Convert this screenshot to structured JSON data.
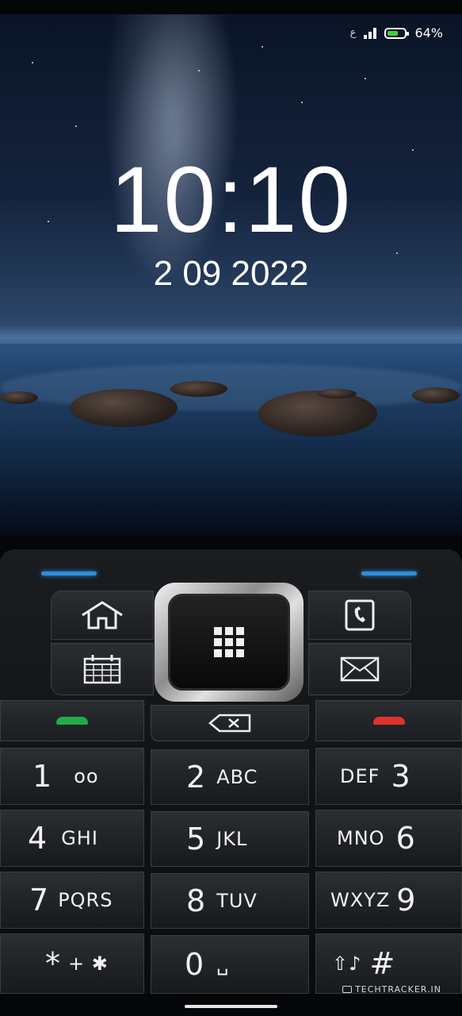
{
  "status": {
    "sim_label": "ع",
    "battery_percent_text": "64%",
    "battery_level": 0.64,
    "battery_color": "#3fd13b"
  },
  "lockscreen": {
    "time": "10:10",
    "date": "2 09 2022"
  },
  "keypad": {
    "accent_color": "#2f8ddf",
    "soft_keys": {
      "home": "home-icon",
      "contacts": "contacts-icon",
      "calendar": "calendar-icon",
      "messages": "envelope-icon",
      "menu": "app-grid-icon",
      "backspace": "backspace-icon",
      "call": "call-icon",
      "end": "end-call-icon"
    },
    "keys": [
      {
        "num": "1",
        "letters": "ᴏᴏ"
      },
      {
        "num": "2",
        "letters": "ABC"
      },
      {
        "num": "3",
        "letters": "DEF"
      },
      {
        "num": "4",
        "letters": "GHI"
      },
      {
        "num": "5",
        "letters": "JKL"
      },
      {
        "num": "6",
        "letters": "MNO"
      },
      {
        "num": "7",
        "letters": "PQRS"
      },
      {
        "num": "8",
        "letters": "TUV"
      },
      {
        "num": "9",
        "letters": "WXYZ"
      },
      {
        "num": "*",
        "letters": "+ ✱"
      },
      {
        "num": "0",
        "letters": "␣"
      },
      {
        "num": "#",
        "letters": "⇧♪"
      }
    ]
  },
  "watermark": "TECHTRACKER.IN"
}
